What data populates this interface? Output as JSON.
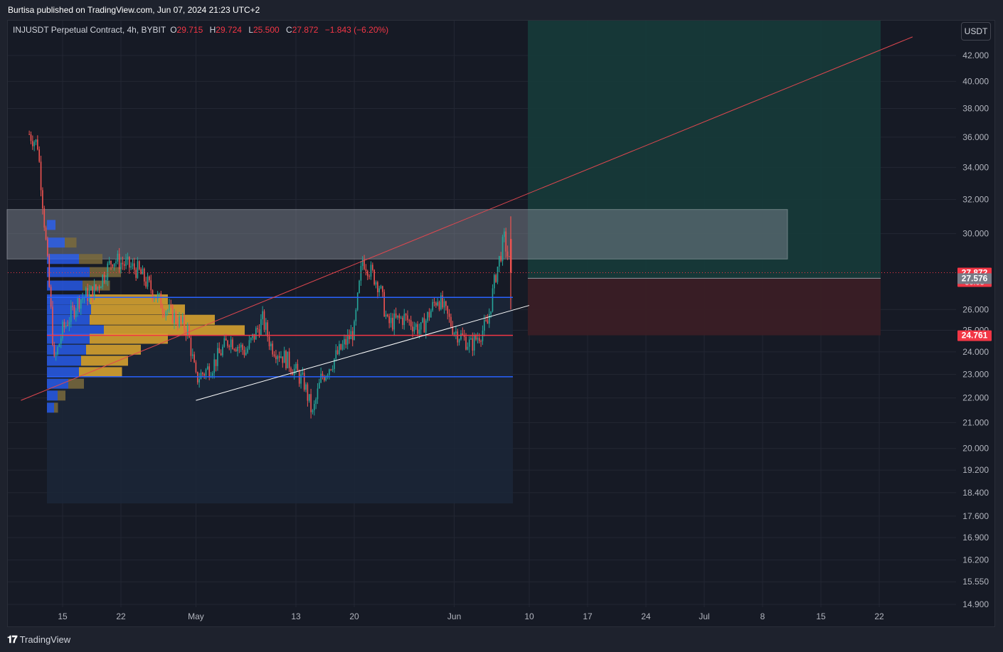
{
  "header": {
    "published": "Burtisa published on TradingView.com, Jun 07, 2024 21:23 UTC+2"
  },
  "legend": {
    "symbol": "INJUSDT Perpetual Contract, 4h, BYBIT",
    "open_label": "O",
    "open": "29.715",
    "high_label": "H",
    "high": "29.724",
    "low_label": "L",
    "low": "25.500",
    "close_label": "C",
    "close": "27.872",
    "change": "−1.843 (−6.20%)"
  },
  "currency_button": "USDT",
  "footer": {
    "brand": "TradingView",
    "logo_icon": "tradingview-logo-icon"
  },
  "colors": {
    "background": "#161a25",
    "up": "#26a69a",
    "down": "#ef5350",
    "trend_red": "#e0474f",
    "support_white": "#ffffff",
    "level_blue": "#2962ff",
    "level_red": "#f23645",
    "profit_zone": "#163b3a",
    "loss_zone": "#3a1d25",
    "vp_blue": "#2962ff",
    "vp_gold": "#e0a82e"
  },
  "chart_data": {
    "type": "candlestick",
    "symbol": "INJUSDT",
    "timeframe": "4h",
    "scale": "log",
    "x_ticks": [
      "15",
      "22",
      "May",
      "13",
      "20",
      "Jun",
      "10",
      "17",
      "24",
      "Jul",
      "8",
      "15",
      "22"
    ],
    "y_ticks": [
      "42.000",
      "40.000",
      "38.000",
      "36.000",
      "34.000",
      "32.000",
      "30.000",
      "26.000",
      "25.000",
      "24.000",
      "23.000",
      "22.000",
      "21.000",
      "20.000",
      "19.200",
      "18.400",
      "17.600",
      "16.900",
      "16.200",
      "15.550",
      "14.900"
    ],
    "price_labels": [
      {
        "value": 27.872,
        "text": "27.872",
        "sub": "36:03",
        "color": "#f23645"
      },
      {
        "value": 27.576,
        "text": "27.576",
        "color": "#787b86"
      },
      {
        "value": 24.761,
        "text": "24.761",
        "color": "#f23645"
      }
    ],
    "candles_approx": [
      {
        "date": "2024-04-11",
        "price": 36.2
      },
      {
        "date": "2024-04-12",
        "price": 35.5
      },
      {
        "date": "2024-04-13",
        "price": 29.5
      },
      {
        "date": "2024-04-14",
        "price": 23.5
      },
      {
        "date": "2024-04-15",
        "price": 25.0
      },
      {
        "date": "2024-04-17",
        "price": 26.5
      },
      {
        "date": "2024-04-19",
        "price": 27.0
      },
      {
        "date": "2024-04-21",
        "price": 28.6
      },
      {
        "date": "2024-04-24",
        "price": 28.0
      },
      {
        "date": "2024-04-27",
        "price": 26.2
      },
      {
        "date": "2024-04-30",
        "price": 25.0
      },
      {
        "date": "2024-05-01",
        "price": 22.8
      },
      {
        "date": "2024-05-03",
        "price": 23.4
      },
      {
        "date": "2024-05-05",
        "price": 24.6
      },
      {
        "date": "2024-05-07",
        "price": 24.0
      },
      {
        "date": "2024-05-09",
        "price": 25.5
      },
      {
        "date": "2024-05-10",
        "price": 24.3
      },
      {
        "date": "2024-05-12",
        "price": 23.6
      },
      {
        "date": "2024-05-14",
        "price": 22.6
      },
      {
        "date": "2024-05-15",
        "price": 21.3
      },
      {
        "date": "2024-05-16",
        "price": 22.8
      },
      {
        "date": "2024-05-18",
        "price": 23.9
      },
      {
        "date": "2024-05-20",
        "price": 25.0
      },
      {
        "date": "2024-05-21",
        "price": 28.6
      },
      {
        "date": "2024-05-23",
        "price": 27.2
      },
      {
        "date": "2024-05-24",
        "price": 25.3
      },
      {
        "date": "2024-05-26",
        "price": 25.6
      },
      {
        "date": "2024-05-28",
        "price": 25.0
      },
      {
        "date": "2024-05-30",
        "price": 26.6
      },
      {
        "date": "2024-06-01",
        "price": 25.0
      },
      {
        "date": "2024-06-03",
        "price": 24.3
      },
      {
        "date": "2024-06-05",
        "price": 25.3
      },
      {
        "date": "2024-06-06",
        "price": 27.8
      },
      {
        "date": "2024-06-07",
        "price": 29.7
      },
      {
        "date": "2024-06-07T20:00",
        "price": 27.87
      }
    ],
    "horizontal_levels": [
      {
        "price": 26.6,
        "color": "#2962ff"
      },
      {
        "price": 24.761,
        "color": "#f23645"
      },
      {
        "price": 22.9,
        "color": "#2962ff"
      }
    ],
    "resistance_zone": {
      "low": 28.6,
      "high": 31.4
    },
    "trendlines": [
      {
        "from": {
          "date": "2024-04-10",
          "price": 21.9
        },
        "to": {
          "date": "2024-07-26",
          "price": 43.5
        },
        "color": "#e0474f"
      },
      {
        "from": {
          "date": "2024-05-01",
          "price": 21.9
        },
        "to": {
          "date": "2024-06-10",
          "price": 26.2
        },
        "color": "#ffffff"
      }
    ],
    "long_position": {
      "entry": 27.576,
      "target": 42.9,
      "stop": 24.761
    }
  }
}
